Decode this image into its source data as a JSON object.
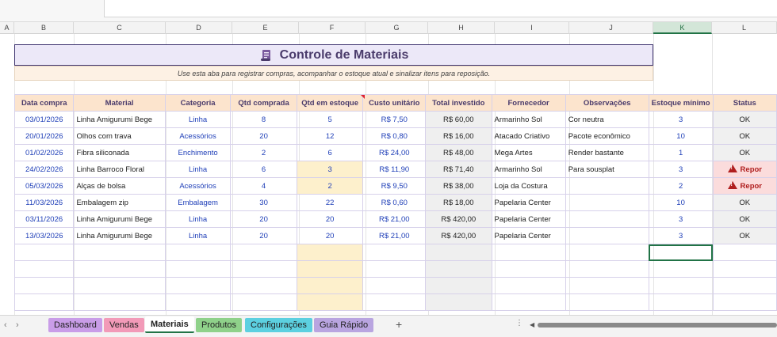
{
  "columns": [
    "A",
    "B",
    "C",
    "D",
    "E",
    "F",
    "G",
    "H",
    "I",
    "J",
    "K",
    "L"
  ],
  "selected_column": "K",
  "title": "Controle de Materiais",
  "subtitle": "Use esta aba para registrar compras, acompanhar o estoque atual e sinalizar itens para reposição.",
  "headers": [
    "Data compra",
    "Material",
    "Categoria",
    "Qtd comprada",
    "Qtd em estoque",
    "Custo unitário",
    "Total investido",
    "Fornecedor",
    "Observações",
    "Estoque mínimo",
    "Status"
  ],
  "rows": [
    {
      "data": "03/01/2026",
      "material": "Linha Amigurumi Bege",
      "categoria": "Linha",
      "qtd_comprada": "8",
      "qtd_estoque": "5",
      "custo": "R$ 7,50",
      "total": "R$ 60,00",
      "fornecedor": "Armarinho Sol",
      "obs": "Cor neutra",
      "minimo": "3",
      "status": "OK"
    },
    {
      "data": "20/01/2026",
      "material": "Olhos com trava",
      "categoria": "Acessórios",
      "qtd_comprada": "20",
      "qtd_estoque": "12",
      "custo": "R$ 0,80",
      "total": "R$ 16,00",
      "fornecedor": "Atacado Criativo",
      "obs": "Pacote econômico",
      "minimo": "10",
      "status": "OK"
    },
    {
      "data": "01/02/2026",
      "material": "Fibra siliconada",
      "categoria": "Enchimento",
      "qtd_comprada": "2",
      "qtd_estoque": "6",
      "custo": "R$ 24,00",
      "total": "R$ 48,00",
      "fornecedor": "Mega Artes",
      "obs": "Render bastante",
      "minimo": "1",
      "status": "OK"
    },
    {
      "data": "24/02/2026",
      "material": "Linha Barroco Floral",
      "categoria": "Linha",
      "qtd_comprada": "6",
      "qtd_estoque": "3",
      "custo": "R$ 11,90",
      "total": "R$ 71,40",
      "fornecedor": "Armarinho Sol",
      "obs": "Para sousplat",
      "minimo": "3",
      "status": "Repor"
    },
    {
      "data": "05/03/2026",
      "material": "Alças de bolsa",
      "categoria": "Acessórios",
      "qtd_comprada": "4",
      "qtd_estoque": "2",
      "custo": "R$ 9,50",
      "total": "R$ 38,00",
      "fornecedor": "Loja da Costura",
      "obs": "",
      "minimo": "2",
      "status": "Repor"
    },
    {
      "data": "11/03/2026",
      "material": "Embalagem zip",
      "categoria": "Embalagem",
      "qtd_comprada": "30",
      "qtd_estoque": "22",
      "custo": "R$ 0,60",
      "total": "R$ 18,00",
      "fornecedor": "Papelaria Center",
      "obs": "",
      "minimo": "10",
      "status": "OK"
    },
    {
      "data": "03/11/2026",
      "material": "Linha Amigurumi Bege",
      "categoria": "Linha",
      "qtd_comprada": "20",
      "qtd_estoque": "20",
      "custo": "R$ 21,00",
      "total": "R$ 420,00",
      "fornecedor": "Papelaria Center",
      "obs": "",
      "minimo": "3",
      "status": "OK"
    },
    {
      "data": "13/03/2026",
      "material": "Linha Amigurumi Bege",
      "categoria": "Linha",
      "qtd_comprada": "20",
      "qtd_estoque": "20",
      "custo": "R$ 21,00",
      "total": "R$ 420,00",
      "fornecedor": "Papelaria Center",
      "obs": "",
      "minimo": "3",
      "status": "OK"
    }
  ],
  "tabs": [
    {
      "label": "Dashboard",
      "color": "#c99de8"
    },
    {
      "label": "Vendas",
      "color": "#f29ab8"
    },
    {
      "label": "Materiais",
      "color": "#ffffff"
    },
    {
      "label": "Produtos",
      "color": "#8fd18a"
    },
    {
      "label": "Configurações",
      "color": "#5cd0e0"
    },
    {
      "label": "Guia Rápido",
      "color": "#b9a5e0"
    }
  ],
  "active_tab": "Materiais",
  "add_sheet_label": "+"
}
